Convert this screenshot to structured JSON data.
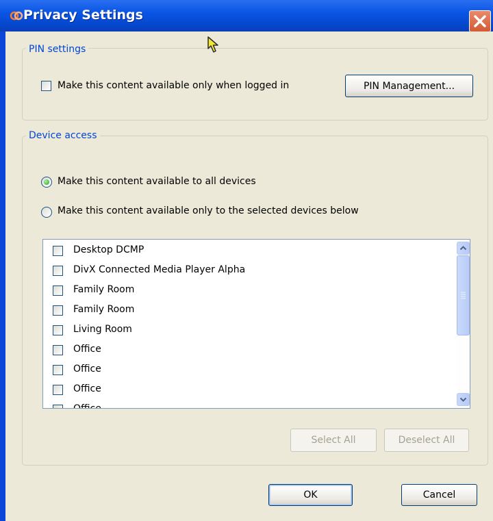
{
  "window": {
    "title": "Privacy Settings",
    "title_icon": "divx-logo-icon",
    "close_icon": "close-icon"
  },
  "pin_settings": {
    "group_title": "PIN settings",
    "checkbox_label": "Make this content available only when logged in",
    "checkbox_checked": false,
    "pin_button": "PIN Management..."
  },
  "device_access": {
    "group_title": "Device access",
    "options": [
      {
        "label": "Make this content available to all devices",
        "selected": true
      },
      {
        "label": "Make this content available only to the selected devices below",
        "selected": false
      }
    ],
    "devices": [
      {
        "label": "Desktop DCMP",
        "checked": false
      },
      {
        "label": "DivX Connected Media Player Alpha",
        "checked": false
      },
      {
        "label": "Family Room",
        "checked": false
      },
      {
        "label": "Family Room",
        "checked": false
      },
      {
        "label": "Living Room",
        "checked": false
      },
      {
        "label": "Office",
        "checked": false
      },
      {
        "label": "Office",
        "checked": false
      },
      {
        "label": "Office",
        "checked": false
      },
      {
        "label": "Office",
        "checked": false
      }
    ],
    "select_all": "Select All",
    "deselect_all": "Deselect All"
  },
  "footer": {
    "ok": "OK",
    "cancel": "Cancel"
  },
  "colors": {
    "title_bar": "#0a55e6",
    "group_title": "#0046d5",
    "dialog_bg": "#ece9d8",
    "close_button": "#d35a35"
  }
}
